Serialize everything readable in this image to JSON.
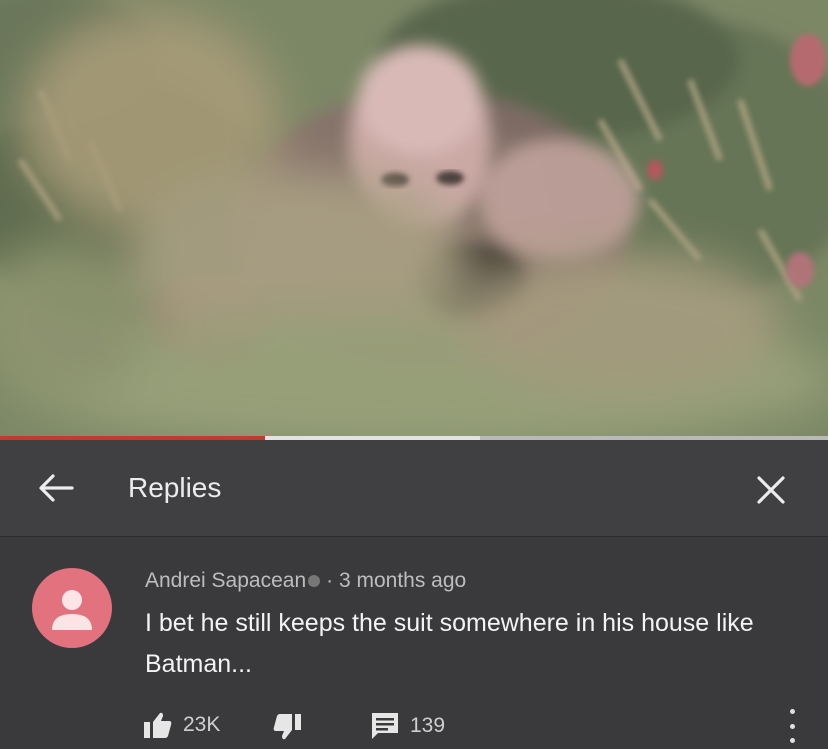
{
  "video": {
    "progress_fraction": 0.32,
    "buffered_fraction": 0.58
  },
  "header": {
    "title": "Replies",
    "back_icon": "arrow-left-icon",
    "close_icon": "close-icon"
  },
  "comment": {
    "author": "Andrei Sapacean",
    "separator": "·",
    "time": "3 months ago",
    "text": "I bet he still keeps the suit somewhere in his house like Batman...",
    "avatar_color": "#e2737e",
    "likes": "23K",
    "replies": "139"
  },
  "colors": {
    "progress": "#c43a2e",
    "panel": "#3a3a3c",
    "header": "#404042"
  }
}
